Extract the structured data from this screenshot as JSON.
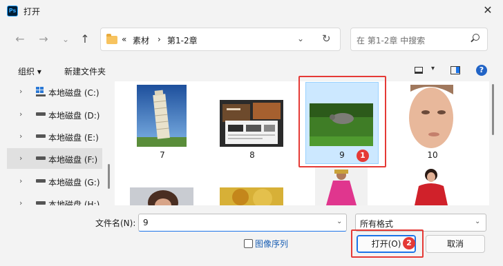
{
  "window": {
    "app_icon_text": "Ps",
    "title": "打开",
    "close_glyph": "✕"
  },
  "nav": {
    "back": "←",
    "forward": "→",
    "recent": "⌄",
    "up": "↑"
  },
  "address": {
    "overflow": "«",
    "crumbs": [
      "素材",
      "第1-2章"
    ],
    "sep": "›",
    "chevron": "⌄",
    "refresh": "↻"
  },
  "search": {
    "placeholder": "在 第1-2章 中搜索"
  },
  "toolbar": {
    "organize": "组织 ▾",
    "new_folder": "新建文件夹",
    "view_chev": "▾",
    "help": "?"
  },
  "sidebar": {
    "chevron": "›",
    "items": [
      {
        "label": "本地磁盘 (C:)",
        "selected": false
      },
      {
        "label": "本地磁盘 (D:)",
        "selected": false
      },
      {
        "label": "本地磁盘 (E:)",
        "selected": false
      },
      {
        "label": "本地磁盘 (F:)",
        "selected": true
      },
      {
        "label": "本地磁盘 (G:)",
        "selected": false
      },
      {
        "label": "本地磁盘 (H:)",
        "selected": false
      }
    ]
  },
  "files": [
    {
      "name": "7",
      "depicts": "leaning-tower"
    },
    {
      "name": "8",
      "depicts": "website-screens"
    },
    {
      "name": "9",
      "depicts": "bird-on-grass",
      "selected": true
    },
    {
      "name": "10",
      "depicts": "face-portrait"
    },
    {
      "name": "",
      "depicts": "woman-portrait"
    },
    {
      "name": "",
      "depicts": "autumn-tree"
    },
    {
      "name": "",
      "depicts": "woman-pink-dress"
    },
    {
      "name": "",
      "depicts": "woman-red-dress"
    }
  ],
  "annotations": {
    "badge1": "1",
    "badge2": "2",
    "color": "#e53935"
  },
  "bottom": {
    "filename_label": "文件名(N):",
    "filename_value": "9",
    "filetype_value": "所有格式",
    "sequence_label": "图像序列",
    "open_button": "打开(O)",
    "cancel_button": "取消",
    "chevron": "⌄"
  }
}
